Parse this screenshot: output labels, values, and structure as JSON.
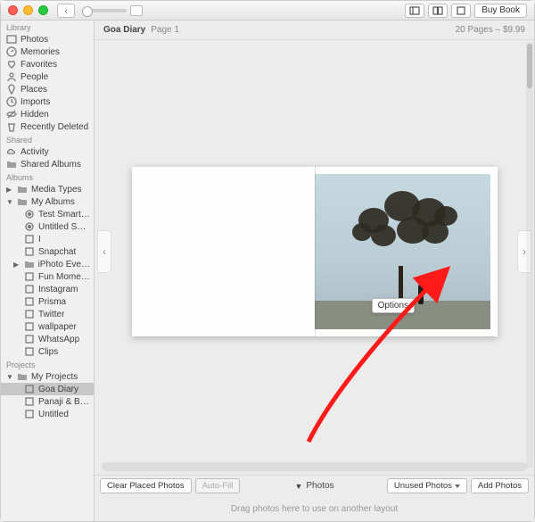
{
  "toolbar": {
    "buy_label": "Buy Book"
  },
  "sidebar": {
    "sections": {
      "library": "Library",
      "shared": "Shared",
      "albums": "Albums",
      "projects": "Projects"
    },
    "library_items": [
      "Photos",
      "Memories",
      "Favorites",
      "People",
      "Places",
      "Imports",
      "Hidden",
      "Recently Deleted"
    ],
    "shared_items": [
      "Activity",
      "Shared Albums"
    ],
    "albums_top": [
      "Media Types",
      "My Albums"
    ],
    "my_albums": [
      "Test Smart A...",
      "Untitled Sma...",
      "I",
      "Snapchat",
      "iPhoto Events",
      "Fun Moments",
      "Instagram",
      "Prisma",
      "Twitter",
      "wallpaper",
      "WhatsApp",
      "Clips"
    ],
    "projects_items": [
      "My Projects",
      "Goa Diary",
      "Panaji & Bard...",
      "Untitled"
    ]
  },
  "header": {
    "title": "Goa Diary",
    "subtitle": "Page 1",
    "info": "20 Pages – $9.99"
  },
  "options_popover": "Options",
  "bottom": {
    "clear": "Clear Placed Photos",
    "autofill": "Auto-Fill",
    "photos": "Photos",
    "unused": "Unused Photos",
    "add": "Add Photos"
  },
  "footer_hint": "Drag photos here to use on another layout"
}
